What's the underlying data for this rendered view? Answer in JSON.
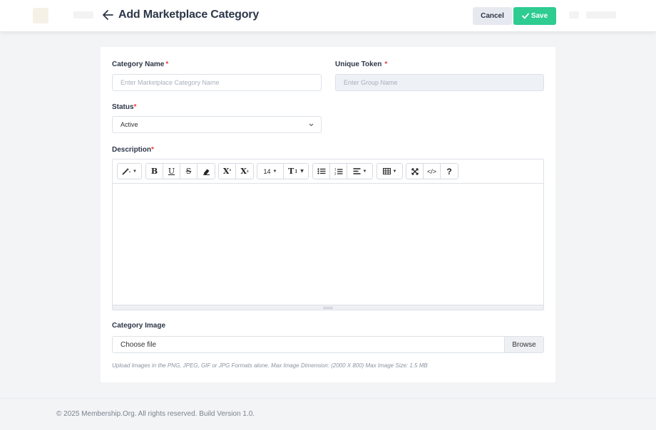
{
  "header": {
    "title": "Add Marketplace Category",
    "cancel_label": "Cancel",
    "save_label": "Save"
  },
  "form": {
    "category_name": {
      "label": "Category Name",
      "required_mark": "*",
      "placeholder": "Enter Marketplace Category Name",
      "value": ""
    },
    "unique_token": {
      "label": "Unique Token",
      "required_mark": "*",
      "placeholder": "Enter Group Name",
      "value": ""
    },
    "status": {
      "label": "Status",
      "required_mark": "*",
      "selected": "Active"
    },
    "description": {
      "label": "Description",
      "required_mark": "*",
      "font_size": "14"
    },
    "category_image": {
      "label": "Category Image",
      "file_label": "Choose file",
      "browse_label": "Browse",
      "help": "Upload Images in the PNG, JPEG, GIF or JPG Formats alone. Max Image Dimension: (2000 X 800) Max Image Size: 1.5 MB"
    }
  },
  "footer": {
    "text": "© 2025 Membership.Org. All rights reserved. Build Version 1.0."
  },
  "colors": {
    "accent": "#2ecc91",
    "required": "#e53e3e",
    "title": "#2d3748"
  },
  "icons": {
    "back": "arrow-left-icon",
    "save": "check-icon",
    "toolbar": [
      "magic-wand-icon",
      "bold-icon",
      "underline-icon",
      "strikethrough-icon",
      "eraser-icon",
      "superscript-icon",
      "subscript-icon",
      "font-size-dropdown",
      "text-height-icon",
      "unordered-list-icon",
      "ordered-list-icon",
      "align-icon",
      "table-icon",
      "fullscreen-icon",
      "code-view-icon",
      "help-icon"
    ]
  }
}
